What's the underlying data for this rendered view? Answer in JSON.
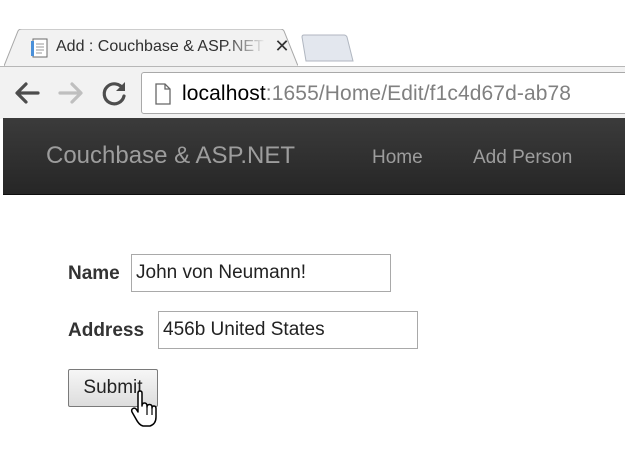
{
  "browser": {
    "tab": {
      "title": "Add : Couchbase & ASP.NET",
      "favicon": "document-icon",
      "close_glyph": "✕"
    },
    "new_tab": "new-tab-button",
    "toolbar": {
      "back": "back-arrow-icon",
      "forward": "forward-arrow-icon",
      "reload": "reload-icon"
    },
    "address": {
      "host": "localhost",
      "rest": ":1655/Home/Edit/f1c4d67d-ab78"
    }
  },
  "navbar": {
    "brand": "Couchbase & ASP.NET",
    "links": [
      "Home",
      "Add Person"
    ]
  },
  "form": {
    "name_label": "Name",
    "name_value": "John von Neumann!",
    "address_label": "Address",
    "address_value": "456b United States",
    "submit_label": "Submit"
  },
  "colors": {
    "navbar_bg": "#2b2b2b",
    "navbar_text": "#9d9d9d",
    "url_host": "#000000",
    "url_rest": "#808080"
  }
}
